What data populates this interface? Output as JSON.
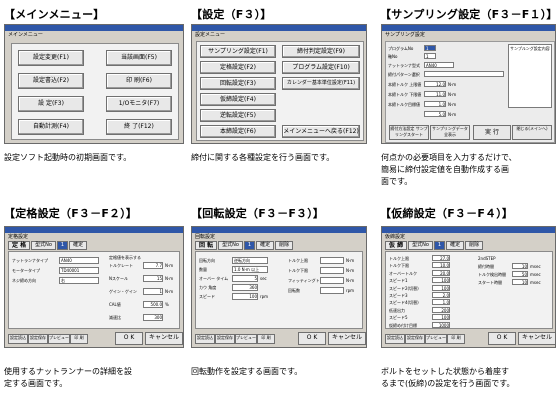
{
  "p1": {
    "title": "【メインメニュー】",
    "window_name": "メインメニュー",
    "buttons": [
      "設定変更(F1)",
      "当該画面(F5)",
      "設定書込(F2)",
      "印 刷(F6)",
      "設 定(F3)",
      "1/Oモニタ(F7)",
      "自動計測(F4)",
      "終 了(F12)"
    ],
    "caption": [
      "設定ソフト起動時の初期画面です。"
    ]
  },
  "p2": {
    "title": "【設定（F３）】",
    "window_name": "設定メニュー",
    "buttons": [
      "サンプリング設定(F1)",
      "締付判定設定(F9)",
      "定格設定(F2)",
      "プログラム設定(F10)",
      "回転設定(F3)",
      "カレンダー基本単位設定(F11)",
      "仮締設定(F4)",
      "",
      "逆転設定(F5)",
      "",
      "本締設定(F6)",
      "メインメニューへ戻る(F12)"
    ],
    "caption": [
      "締付に関する各種設定を行う画面です。"
    ]
  },
  "p3": {
    "title": "【サンプリング設定（F３－F１）】",
    "window_name": "サンプリング設定",
    "fields": [
      {
        "label": "プログラムNo",
        "value": "1"
      },
      {
        "label": "軸No",
        "value": "1"
      },
      {
        "label": "ナットランナ型式",
        "value": "AN40"
      },
      {
        "label": "締付パターン選択",
        "value": ""
      },
      {
        "label": "本締トルク 上限値",
        "value": "12.0"
      },
      {
        "label": "本締トルク 下限値",
        "value": "11.0"
      },
      {
        "label": "本締トルク目標値",
        "value": "1.0"
      },
      {
        "label": "",
        "value": "5.0"
      }
    ],
    "unit": "N·m",
    "right_label": "サンプルング設定内容",
    "bottom_buttons": [
      "締付方法設定 サンプリングスタート",
      "サンプリングデータ 全表示",
      "実 行",
      "閉じる(メインへ)"
    ],
    "caption": [
      "何点かの必要項目を入力するだけで、",
      "簡易に締付設定値を自動作成する画",
      "面です。"
    ]
  },
  "p4": {
    "title": "【定格設定（F３－F２）】",
    "window_name": "定格設定",
    "header_label": "定 格",
    "tab_prefix": "型式No",
    "tab_no": "1",
    "tabs": [
      "確定"
    ],
    "left_fields": [
      {
        "label": "ナットランナタイプ",
        "value": "AN40"
      },
      {
        "label": "モータータイプ",
        "value": "TD40001"
      },
      {
        "label": "ネジ締め方向",
        "value": "右"
      }
    ],
    "right_title": "定格値を表示する",
    "right_fields": [
      {
        "label": "トルクレート",
        "value": "7.7",
        "unit": "N·m"
      },
      {
        "label": "Nスケール",
        "value": "15",
        "unit": "N·m"
      },
      {
        "label": "ゲイン・ゲイン",
        "value": "1",
        "unit": "N·m"
      },
      {
        "label": "CAL値",
        "value": "500.0",
        "unit": "%"
      },
      {
        "label": "減速比",
        "value": "300",
        "unit": ""
      }
    ],
    "bottom_small": [
      "設定読込",
      "設定保存",
      "プレビュー",
      "印 刷"
    ],
    "ok": "O K",
    "cancel": "キャンセル",
    "caption": [
      "使用するナットランナーの詳細を設",
      "定する画面です。"
    ]
  },
  "p5": {
    "title": "【回転設定（F３－F３）】",
    "window_name": "回転設定",
    "header_label": "回 転",
    "tab_prefix": "型式No",
    "tab_no": "1",
    "tabs": [
      "確定",
      "削除"
    ],
    "left_fields": [
      {
        "label": "回転方向",
        "value": "逆転方向",
        "unit": ""
      },
      {
        "label": "数量",
        "value": "1.0 N·m 以上",
        "unit": ""
      },
      {
        "label": "オーバー タイム",
        "value": "5",
        "unit": "sec"
      },
      {
        "label": "カウ 角度",
        "value": "360",
        "unit": ""
      },
      {
        "label": "スピード",
        "value": "100",
        "unit": "rpm"
      }
    ],
    "right_fields": [
      {
        "label": "トルク上限",
        "value": "",
        "unit": "N·m"
      },
      {
        "label": "トルク下限",
        "value": "",
        "unit": "N·m"
      },
      {
        "label": "フィッティングトルク",
        "value": "",
        "unit": "N·m"
      },
      {
        "label": "回転数",
        "value": "",
        "unit": "rpm"
      }
    ],
    "bottom_small": [
      "設定読込",
      "設定保存",
      "プレビュー",
      "印 刷"
    ],
    "ok": "O K",
    "cancel": "キャンセル",
    "caption": [
      "回転動作を設定する画面です。"
    ]
  },
  "p6": {
    "title": "【仮締設定（F３－F４）】",
    "window_name": "仮締設定",
    "header_label": "仮 締",
    "tab_prefix": "型式No",
    "tab_no": "1",
    "tabs": [
      "確定",
      "削除"
    ],
    "left_fields": [
      {
        "label": "トルク上限",
        "value": "27.0"
      },
      {
        "label": "トルク下限",
        "value": "10.0"
      },
      {
        "label": "オーバートルク",
        "value": "20.0"
      },
      {
        "label": "スピード1",
        "value": "100"
      },
      {
        "label": "スピード2(切替)",
        "value": "100"
      },
      {
        "label": "スピード3",
        "value": "2.0"
      },
      {
        "label": "スピード4(切替)",
        "value": "1.0"
      },
      {
        "label": "低速出力",
        "value": "200"
      },
      {
        "label": "スピード5",
        "value": "100"
      },
      {
        "label": "仮締め付け目標",
        "value": "1000"
      }
    ],
    "right_fields": [
      {
        "label": "2ndSTEP",
        "value": "",
        "unit": ""
      },
      {
        "label": "締付時間",
        "value": "10",
        "unit": "msec"
      },
      {
        "label": "トルク検出時間",
        "value": "50",
        "unit": "msec"
      },
      {
        "label": "スタート時間",
        "value": "10",
        "unit": "msec"
      }
    ],
    "bottom_small": [
      "設定読込",
      "設定保存",
      "プレビュー",
      "印 刷"
    ],
    "ok": "O K",
    "cancel": "キャンセル",
    "caption": [
      "ボルトをセットした状態から着座す",
      "るまで(仮締)の設定を行う画面です。"
    ]
  }
}
